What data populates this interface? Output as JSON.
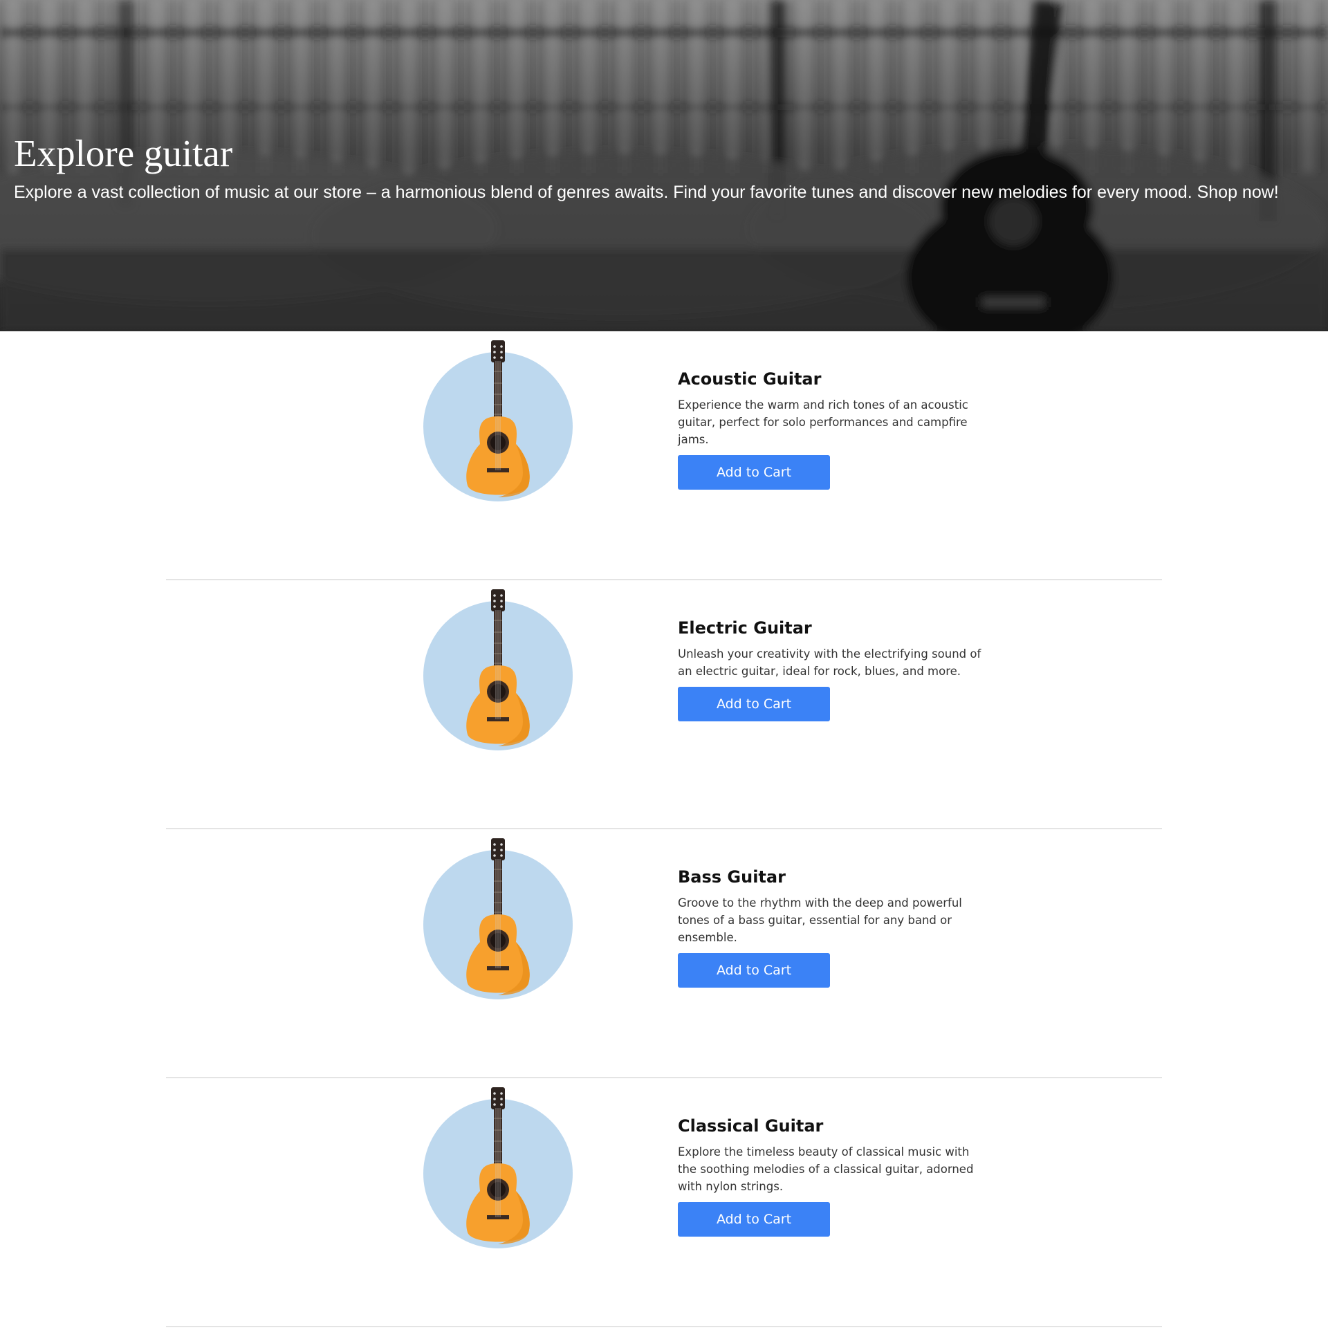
{
  "hero": {
    "title": "Explore guitar",
    "subtitle": "Explore a vast collection of music at our store – a harmonious blend of genres awaits. Find your favorite tunes and discover new melodies for every mood. Shop now!"
  },
  "products": [
    {
      "name": "Acoustic Guitar",
      "description": "Experience the warm and rich tones of an acoustic guitar, perfect for solo performances and campfire jams.",
      "button_label": "Add to Cart",
      "image_icon": "guitar-icon"
    },
    {
      "name": "Electric Guitar",
      "description": "Unleash your creativity with the electrifying sound of an electric guitar, ideal for rock, blues, and more.",
      "button_label": "Add to Cart",
      "image_icon": "guitar-icon"
    },
    {
      "name": "Bass Guitar",
      "description": "Groove to the rhythm with the deep and powerful tones of a bass guitar, essential for any band or ensemble.",
      "button_label": "Add to Cart",
      "image_icon": "guitar-icon"
    },
    {
      "name": "Classical Guitar",
      "description": "Explore the timeless beauty of classical music with the soothing melodies of a classical guitar, adorned with nylon strings.",
      "button_label": "Add to Cart",
      "image_icon": "guitar-icon"
    }
  ],
  "colors": {
    "button_bg": "#3b82f6",
    "circle_bg": "#bdd8ee",
    "guitar_body": "#f7a02d",
    "divider": "#e4e4e4"
  }
}
